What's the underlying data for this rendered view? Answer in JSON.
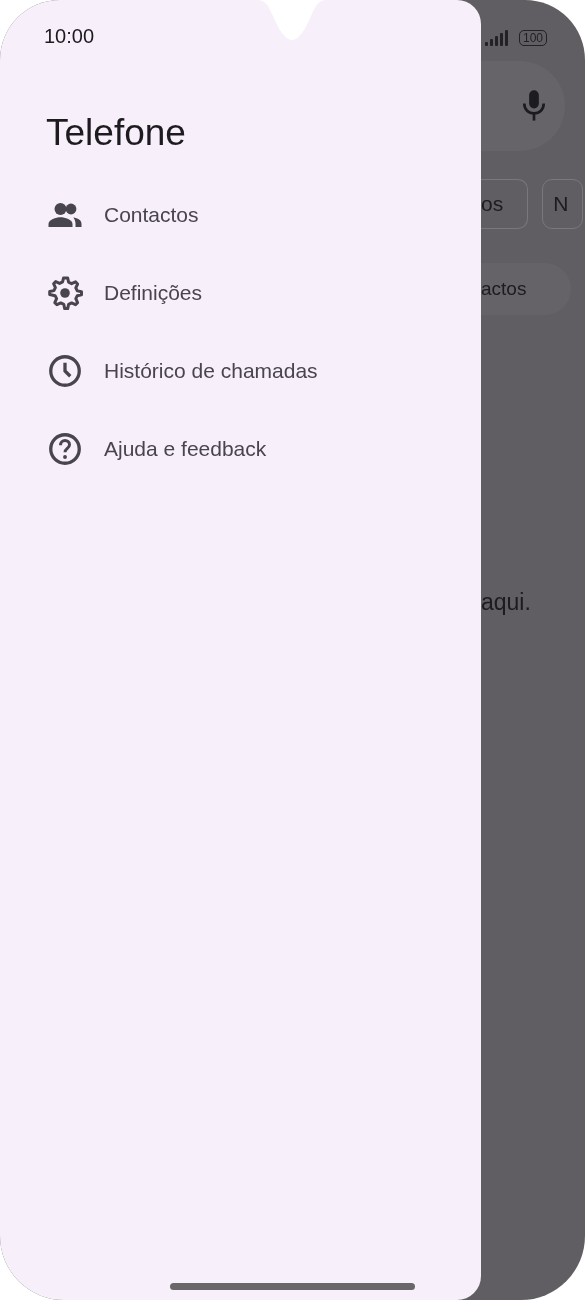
{
  "status_bar": {
    "time": "10:00",
    "battery": "100"
  },
  "drawer": {
    "title": "Telefone",
    "items": [
      {
        "label": "Contactos"
      },
      {
        "label": "Definições"
      },
      {
        "label": "Histórico de chamadas"
      },
      {
        "label": "Ajuda e feedback"
      }
    ]
  },
  "background_app": {
    "chips": [
      "os",
      "N"
    ],
    "pill_label": "actos",
    "message": "aqui."
  }
}
